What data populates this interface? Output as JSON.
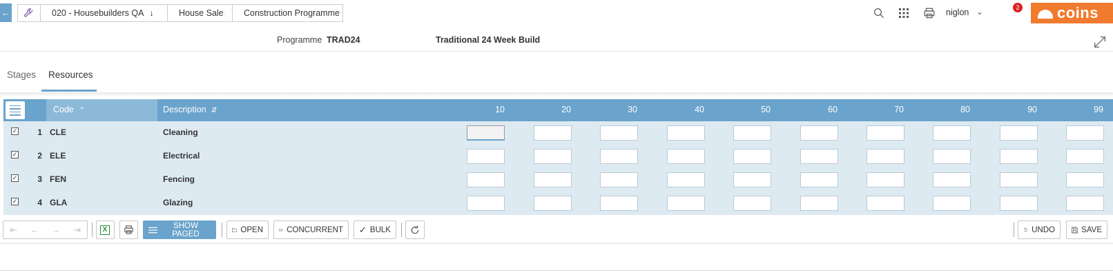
{
  "breadcrumbs": {
    "company": "020 - Housebuilders QA",
    "module": "House Sales",
    "page": "Construction Programme"
  },
  "user": {
    "name": "niglon",
    "notifications": "2"
  },
  "brand": {
    "logo_text": "coins",
    "logo_color": "#f07b2f",
    "accent": "#6aa3cb"
  },
  "programme": {
    "label": "Programme",
    "code": "TRAD24",
    "description": "Traditional 24 Week Build"
  },
  "tabs": [
    {
      "label": "Stages",
      "active": false
    },
    {
      "label": "Resources",
      "active": true
    }
  ],
  "grid": {
    "columns": {
      "code": "Code",
      "description": "Description"
    },
    "stage_columns": [
      "10",
      "20",
      "30",
      "40",
      "50",
      "60",
      "70",
      "80",
      "90",
      "99"
    ],
    "rows": [
      {
        "num": "1",
        "code": "CLE",
        "description": "Cleaning",
        "checked": true
      },
      {
        "num": "2",
        "code": "ELE",
        "description": "Electrical",
        "checked": true
      },
      {
        "num": "3",
        "code": "FEN",
        "description": "Fencing",
        "checked": true
      },
      {
        "num": "4",
        "code": "GLA",
        "description": "Glazing",
        "checked": true
      }
    ]
  },
  "toolbar": {
    "show_paged": "SHOW PAGED",
    "open": "OPEN",
    "concurrent": "CONCURRENT",
    "bulk": "BULK",
    "undo": "UNDO",
    "save": "SAVE"
  }
}
